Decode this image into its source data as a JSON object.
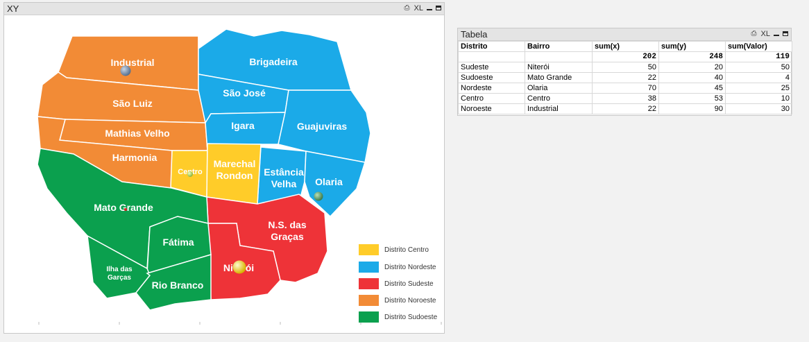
{
  "xy_window": {
    "title": "XY",
    "xl_label": "XL",
    "regions": [
      {
        "label": "Industrial",
        "district": "noroeste"
      },
      {
        "label": "São Luiz",
        "district": "noroeste"
      },
      {
        "label": "Mathias Velho",
        "district": "noroeste"
      },
      {
        "label": "Harmonia",
        "district": "noroeste"
      },
      {
        "label": "Brigadeira",
        "district": "nordeste"
      },
      {
        "label": "São José",
        "district": "nordeste"
      },
      {
        "label": "Igara",
        "district": "nordeste"
      },
      {
        "label": "Guajuviras",
        "district": "nordeste"
      },
      {
        "label": "Estância Velha",
        "district": "nordeste"
      },
      {
        "label": "Olaria",
        "district": "nordeste"
      },
      {
        "label": "Centro",
        "district": "centro"
      },
      {
        "label": "Marechal Rondon",
        "district": "centro"
      },
      {
        "label": "N.S. das Graças",
        "district": "sudeste"
      },
      {
        "label": "Niterói",
        "district": "sudeste"
      },
      {
        "label": "Mato Grande",
        "district": "sudoeste"
      },
      {
        "label": "Fátima",
        "district": "sudoeste"
      },
      {
        "label": "Ilha das Garças",
        "district": "sudoeste"
      },
      {
        "label": "Rio Branco",
        "district": "sudoeste"
      }
    ],
    "legend": [
      {
        "label": "Distrito Centro",
        "color": "#FFCC29"
      },
      {
        "label": "Distrito Nordeste",
        "color": "#1BAAE8"
      },
      {
        "label": "Distrito Sudeste",
        "color": "#EE3338"
      },
      {
        "label": "Distrito Noroeste",
        "color": "#F28B36"
      },
      {
        "label": "Distrito Sudoeste",
        "color": "#0BA04E"
      }
    ]
  },
  "table_window": {
    "title": "Tabela",
    "xl_label": "XL",
    "columns": [
      "Distrito",
      "Bairro",
      "sum(x)",
      "sum(y)",
      "sum(Valor)"
    ],
    "totals": [
      "",
      "",
      "202",
      "248",
      "119"
    ],
    "rows": [
      [
        "Sudeste",
        "Niterói",
        "50",
        "20",
        "50"
      ],
      [
        "Sudoeste",
        "Mato Grande",
        "22",
        "40",
        "4"
      ],
      [
        "Nordeste",
        "Olaria",
        "70",
        "45",
        "25"
      ],
      [
        "Centro",
        "Centro",
        "38",
        "53",
        "10"
      ],
      [
        "Noroeste",
        "Industrial",
        "22",
        "90",
        "30"
      ]
    ]
  },
  "chart_data": {
    "type": "scatter",
    "points": [
      {
        "label": "Niterói",
        "x": 50,
        "y": 20,
        "value": 50
      },
      {
        "label": "Mato Grande",
        "x": 22,
        "y": 40,
        "value": 4
      },
      {
        "label": "Olaria",
        "x": 70,
        "y": 45,
        "value": 25
      },
      {
        "label": "Centro",
        "x": 38,
        "y": 53,
        "value": 10
      },
      {
        "label": "Industrial",
        "x": 22,
        "y": 90,
        "value": 30
      }
    ]
  }
}
